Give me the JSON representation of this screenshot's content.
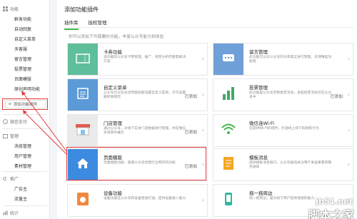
{
  "sidebar": {
    "sections": [
      {
        "label": "功能",
        "icon": "grid-icon"
      },
      {
        "label": "微信支付",
        "icon": "wallet-icon"
      },
      {
        "label": "管理",
        "icon": "folder-icon"
      },
      {
        "label": "推广",
        "icon": "megaphone-icon"
      },
      {
        "label": "统计",
        "icon": "chart-icon"
      }
    ],
    "function_items": [
      "群发功能",
      "自动回复",
      "自定义菜单",
      "多客服",
      "留言管理",
      "投票管理",
      "页面模版",
      "原创声明功能"
    ],
    "add_plugin_label": "添加功能插件",
    "manage_items": [
      "消息管理",
      "用户管理",
      "素材管理"
    ],
    "promo_items": [
      "广告主",
      "流量主"
    ]
  },
  "main": {
    "title": "添加功能插件",
    "tabs": [
      "插件库",
      "授权管理"
    ],
    "intro": "你可以添加下列需要的功能，丰富公众号能力和体验",
    "cards": [
      {
        "title": "卡券功能",
        "desc": "设功能的公众号卡券管理、推广、经营分析的整套解决方案",
        "status": "",
        "color": "#5fbf9a"
      },
      {
        "title": "留言管理",
        "desc": "此功能可以对公众号的文章留言进行管理，支持精选功能等",
        "status": "",
        "color": "#6fa0d8"
      },
      {
        "title": "自定义菜单",
        "desc": "公众号可以在会话界面底部设置自定义菜单，可可设置跳转到网页",
        "status": "已添加",
        "color": "#5b9ad6"
      },
      {
        "title": "投票管理",
        "desc": "此功能是公众号定制投票活动，发起投票活动可在公众号中",
        "status": "已添加",
        "color": "#44a866"
      },
      {
        "title": "门店管理",
        "desc": "通过公众号，对线下实体门店数据进行管理，并在微信多场景中展示",
        "status": "已添加",
        "color": "#e2e2e2"
      },
      {
        "title": "微信连Wi-Fi",
        "desc": "在提供Wi-Fi的场所，打通线上线下的顾客行为",
        "status": "",
        "color": "#44b549"
      },
      {
        "title": "页面模版",
        "desc": "页面模版功能，是使公众号创建行业网页的功能",
        "status": "已添加",
        "color": "#3d8be0"
      },
      {
        "title": "模板消息",
        "desc": "提供模板消息接口，公众号能向关注用户发送重要的服务通知",
        "status": "",
        "color": "#f5a623"
      },
      {
        "title": "设备功能",
        "desc": "设备功能在公众号和设备连接打通，提供设备接入能力",
        "status": "",
        "color": "#f0883e"
      },
      {
        "title": "摇一摇周边",
        "desc": "摇一摇周边，是为线下商户提供连接的能力",
        "status": "",
        "color": "#2fb8a0"
      }
    ]
  },
  "watermark": {
    "line1": "jb51.net",
    "line2": "脚本之家"
  }
}
